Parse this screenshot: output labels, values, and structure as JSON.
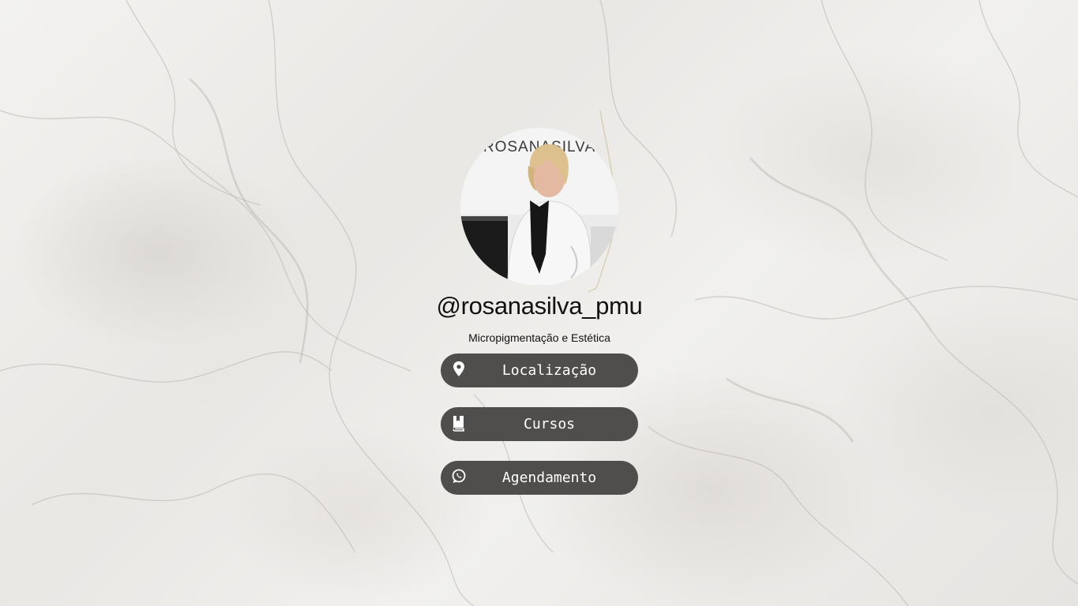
{
  "profile": {
    "handle": "@rosanasilva_pmu",
    "subtitle": "Micropigmentação e Estética",
    "avatar_logo_text": "ROSANASILVA"
  },
  "links": [
    {
      "label": "Localização",
      "icon": "map-pin-icon"
    },
    {
      "label": "Cursos",
      "icon": "bookmark-book-icon"
    },
    {
      "label": "Agendamento",
      "icon": "whatsapp-icon"
    }
  ],
  "colors": {
    "button_bg": "#4f4e4d",
    "button_text": "#ffffff",
    "text": "#111111",
    "background": "#eeecea"
  }
}
